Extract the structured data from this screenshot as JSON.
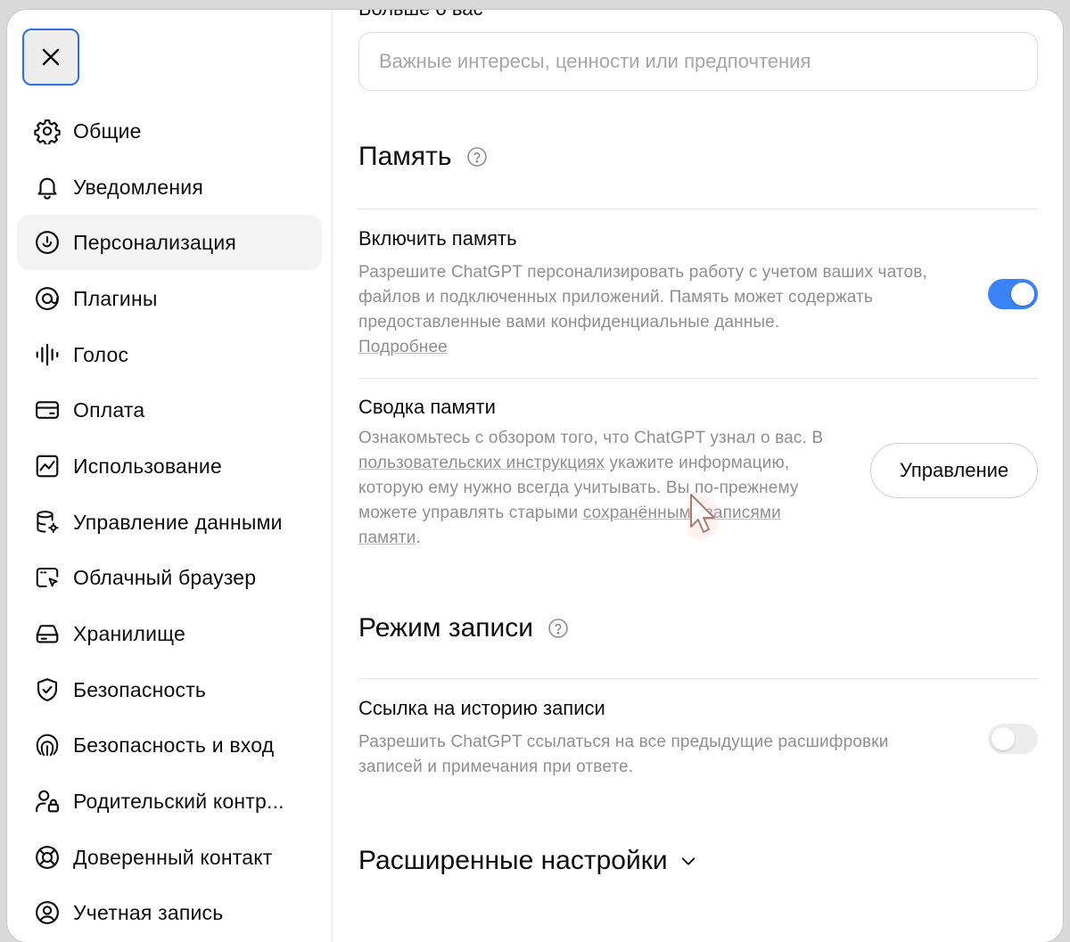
{
  "close_button": {
    "label": "close-icon"
  },
  "sidebar": {
    "items": [
      {
        "label": "Общие",
        "icon": "gear-icon"
      },
      {
        "label": "Уведомления",
        "icon": "bell-icon"
      },
      {
        "label": "Персонализация",
        "icon": "personalization-icon",
        "active": true
      },
      {
        "label": "Плагины",
        "icon": "plugins-icon"
      },
      {
        "label": "Голос",
        "icon": "voice-wave-icon"
      },
      {
        "label": "Оплата",
        "icon": "card-icon"
      },
      {
        "label": "Использование",
        "icon": "usage-chart-icon"
      },
      {
        "label": "Управление данными",
        "icon": "database-gear-icon"
      },
      {
        "label": "Облачный браузер",
        "icon": "cloud-browser-icon"
      },
      {
        "label": "Хранилище",
        "icon": "storage-icon"
      },
      {
        "label": "Безопасность",
        "icon": "shield-check-icon"
      },
      {
        "label": "Безопасность и вход",
        "icon": "fingerprint-icon"
      },
      {
        "label": "Родительский контр...",
        "icon": "parent-lock-icon"
      },
      {
        "label": "Доверенный контакт",
        "icon": "lifebuoy-icon"
      },
      {
        "label": "Учетная запись",
        "icon": "account-icon"
      }
    ]
  },
  "content": {
    "top_cut_label": "Больше о вас",
    "interests_input": {
      "value": "",
      "placeholder": "Важные интересы, ценности или предпочтения"
    },
    "memory": {
      "heading": "Память",
      "enable": {
        "title": "Включить память",
        "description": "Разрешите ChatGPT персонализировать работу с учетом ваших чатов, файлов и подключенных приложений. Память может содержать предоставленные вами конфиденциальные данные.",
        "link": "Подробнее",
        "toggle_on": true
      },
      "summary": {
        "title": "Сводка памяти",
        "desc_part1": "Ознакомьтесь с обзором того, что ChatGPT узнал о вас. В ",
        "desc_link1": "пользовательских инструкциях",
        "desc_part2": " укажите информацию, которую ему нужно всегда учитывать. Вы по-прежнему можете управлять старыми ",
        "desc_link2": "сохранёнными записями памяти",
        "desc_part3": ".",
        "button": "Управление"
      }
    },
    "recording": {
      "heading": "Режим записи",
      "history": {
        "title": "Ссылка на историю записи",
        "description": "Разрешить ChatGPT ссылаться на все предыдущие расшифровки записей и примечания при ответе.",
        "toggle_on": false
      }
    },
    "advanced": {
      "label": "Расширенные настройки"
    }
  },
  "colors": {
    "accent": "#3b82f6",
    "focus_ring": "#2f6fe4",
    "muted_text": "#8f8f8f"
  }
}
